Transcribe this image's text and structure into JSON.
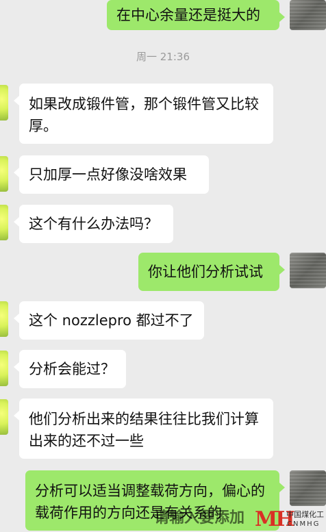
{
  "messages": [
    {
      "id": "m1",
      "side": "right",
      "text": "在中心余量还是挺大的"
    },
    {
      "id": "m2",
      "side": "left",
      "text": "如果改成锻件管，那个锻件管又比较厚。"
    },
    {
      "id": "m3",
      "side": "left",
      "text": "只加厚一点好像没啥效果"
    },
    {
      "id": "m4",
      "side": "left",
      "text": "这个有什么办法吗？"
    },
    {
      "id": "m5",
      "side": "right",
      "text": "你让他们分析试试"
    },
    {
      "id": "m6",
      "side": "left",
      "text": "这个 nozzlepro 都过不了"
    },
    {
      "id": "m7",
      "side": "left",
      "text": "分析会能过？"
    },
    {
      "id": "m8",
      "side": "left",
      "text": "他们分析出来的结果往往比我们计算出来的还不过一些"
    },
    {
      "id": "m9",
      "side": "right",
      "text": "分析可以适当调整载荷方向，偏心的载荷作用的方向还是有关系的"
    }
  ],
  "timestamp": "周一 21:36",
  "watermark": "请输入要添加",
  "logo": {
    "mark": "MH",
    "cn": "中国煤化工",
    "en": "CNMHG"
  },
  "colors": {
    "right_bubble": "#9de86b",
    "left_bubble": "#ffffff",
    "background": "#ebebeb"
  }
}
